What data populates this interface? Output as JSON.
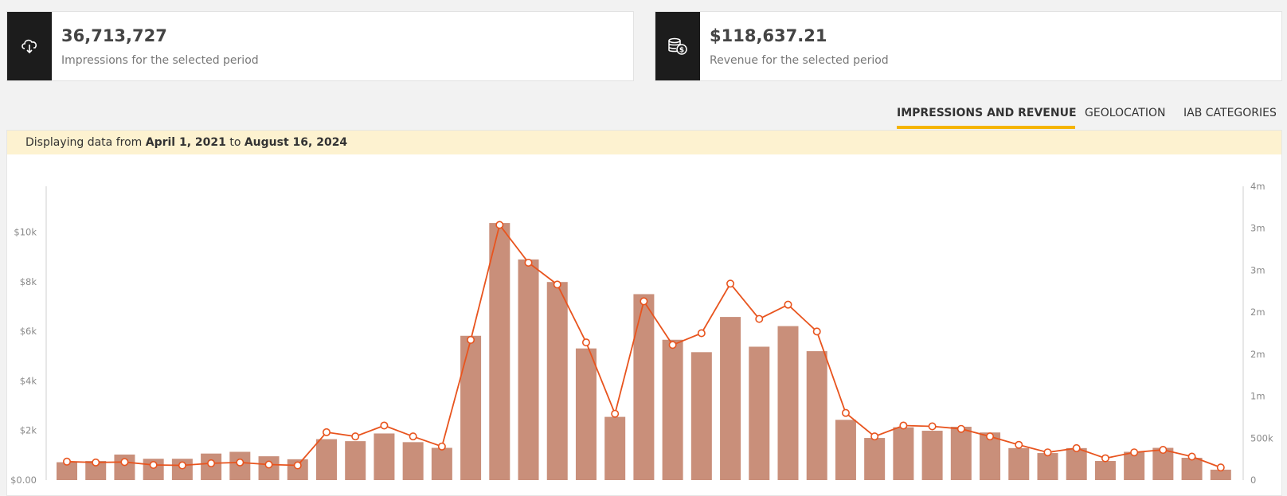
{
  "cards": [
    {
      "value": "36,713,727",
      "label": "Impressions for the selected period",
      "icon": "cloud-download-icon"
    },
    {
      "value": "$118,637.21",
      "label": "Revenue for the selected period",
      "icon": "coins-dollar-icon"
    }
  ],
  "tabs": [
    "IMPRESSIONS AND REVENUE",
    "GEOLOCATION",
    "IAB CATEGORIES"
  ],
  "active_tab": "IMPRESSIONS AND REVENUE",
  "banner": {
    "prefix": "Displaying data from",
    "start": "April 1, 2021",
    "mid": "to",
    "end": "August 16, 2024"
  },
  "colors": {
    "bar": "#c98f7a",
    "line": "#e8541e",
    "accent": "#f5b400",
    "icon_bg": "#1c1c1c",
    "banner_bg": "#fdf2d0"
  },
  "chart_data": {
    "type": "bar",
    "categories": [],
    "series": [
      {
        "type": "bar",
        "axis": "left",
        "values": [
          720,
          770,
          1030,
          860,
          860,
          1070,
          1140,
          960,
          840,
          1650,
          1570,
          1880,
          1530,
          1300,
          5820,
          10370,
          8900,
          7990,
          5310,
          2550,
          7500,
          5660,
          5160,
          6580,
          5380,
          6210,
          5200,
          2430,
          1700,
          2130,
          1990,
          2150,
          1920,
          1290,
          1090,
          1290,
          770,
          1140,
          1300,
          900,
          420
        ]
      },
      {
        "type": "line",
        "axis": "right",
        "values": [
          220000,
          210000,
          215000,
          180000,
          175000,
          200000,
          210000,
          185000,
          175000,
          570000,
          520000,
          650000,
          520000,
          400000,
          1670000,
          3040000,
          2590000,
          2330000,
          1640000,
          790000,
          2130000,
          1610000,
          1750000,
          2340000,
          1920000,
          2090000,
          1770000,
          800000,
          520000,
          650000,
          640000,
          610000,
          520000,
          420000,
          330000,
          380000,
          260000,
          330000,
          360000,
          280000,
          150000
        ]
      }
    ],
    "y_left": {
      "ticks": [
        "$0.00",
        "$2k",
        "$4k",
        "$6k",
        "$8k",
        "$10k"
      ],
      "values": [
        0,
        2000,
        4000,
        6000,
        8000,
        10000
      ],
      "max": 11850
    },
    "y_right": {
      "ticks": [
        "0",
        "500k",
        "1m",
        "2m",
        "2m",
        "3m",
        "3m",
        "4m"
      ],
      "values": [
        0,
        500000,
        1000000,
        1500000,
        2000000,
        2500000,
        3000000,
        3500000
      ],
      "max": 3500000
    },
    "grid": false,
    "legend": "none"
  }
}
